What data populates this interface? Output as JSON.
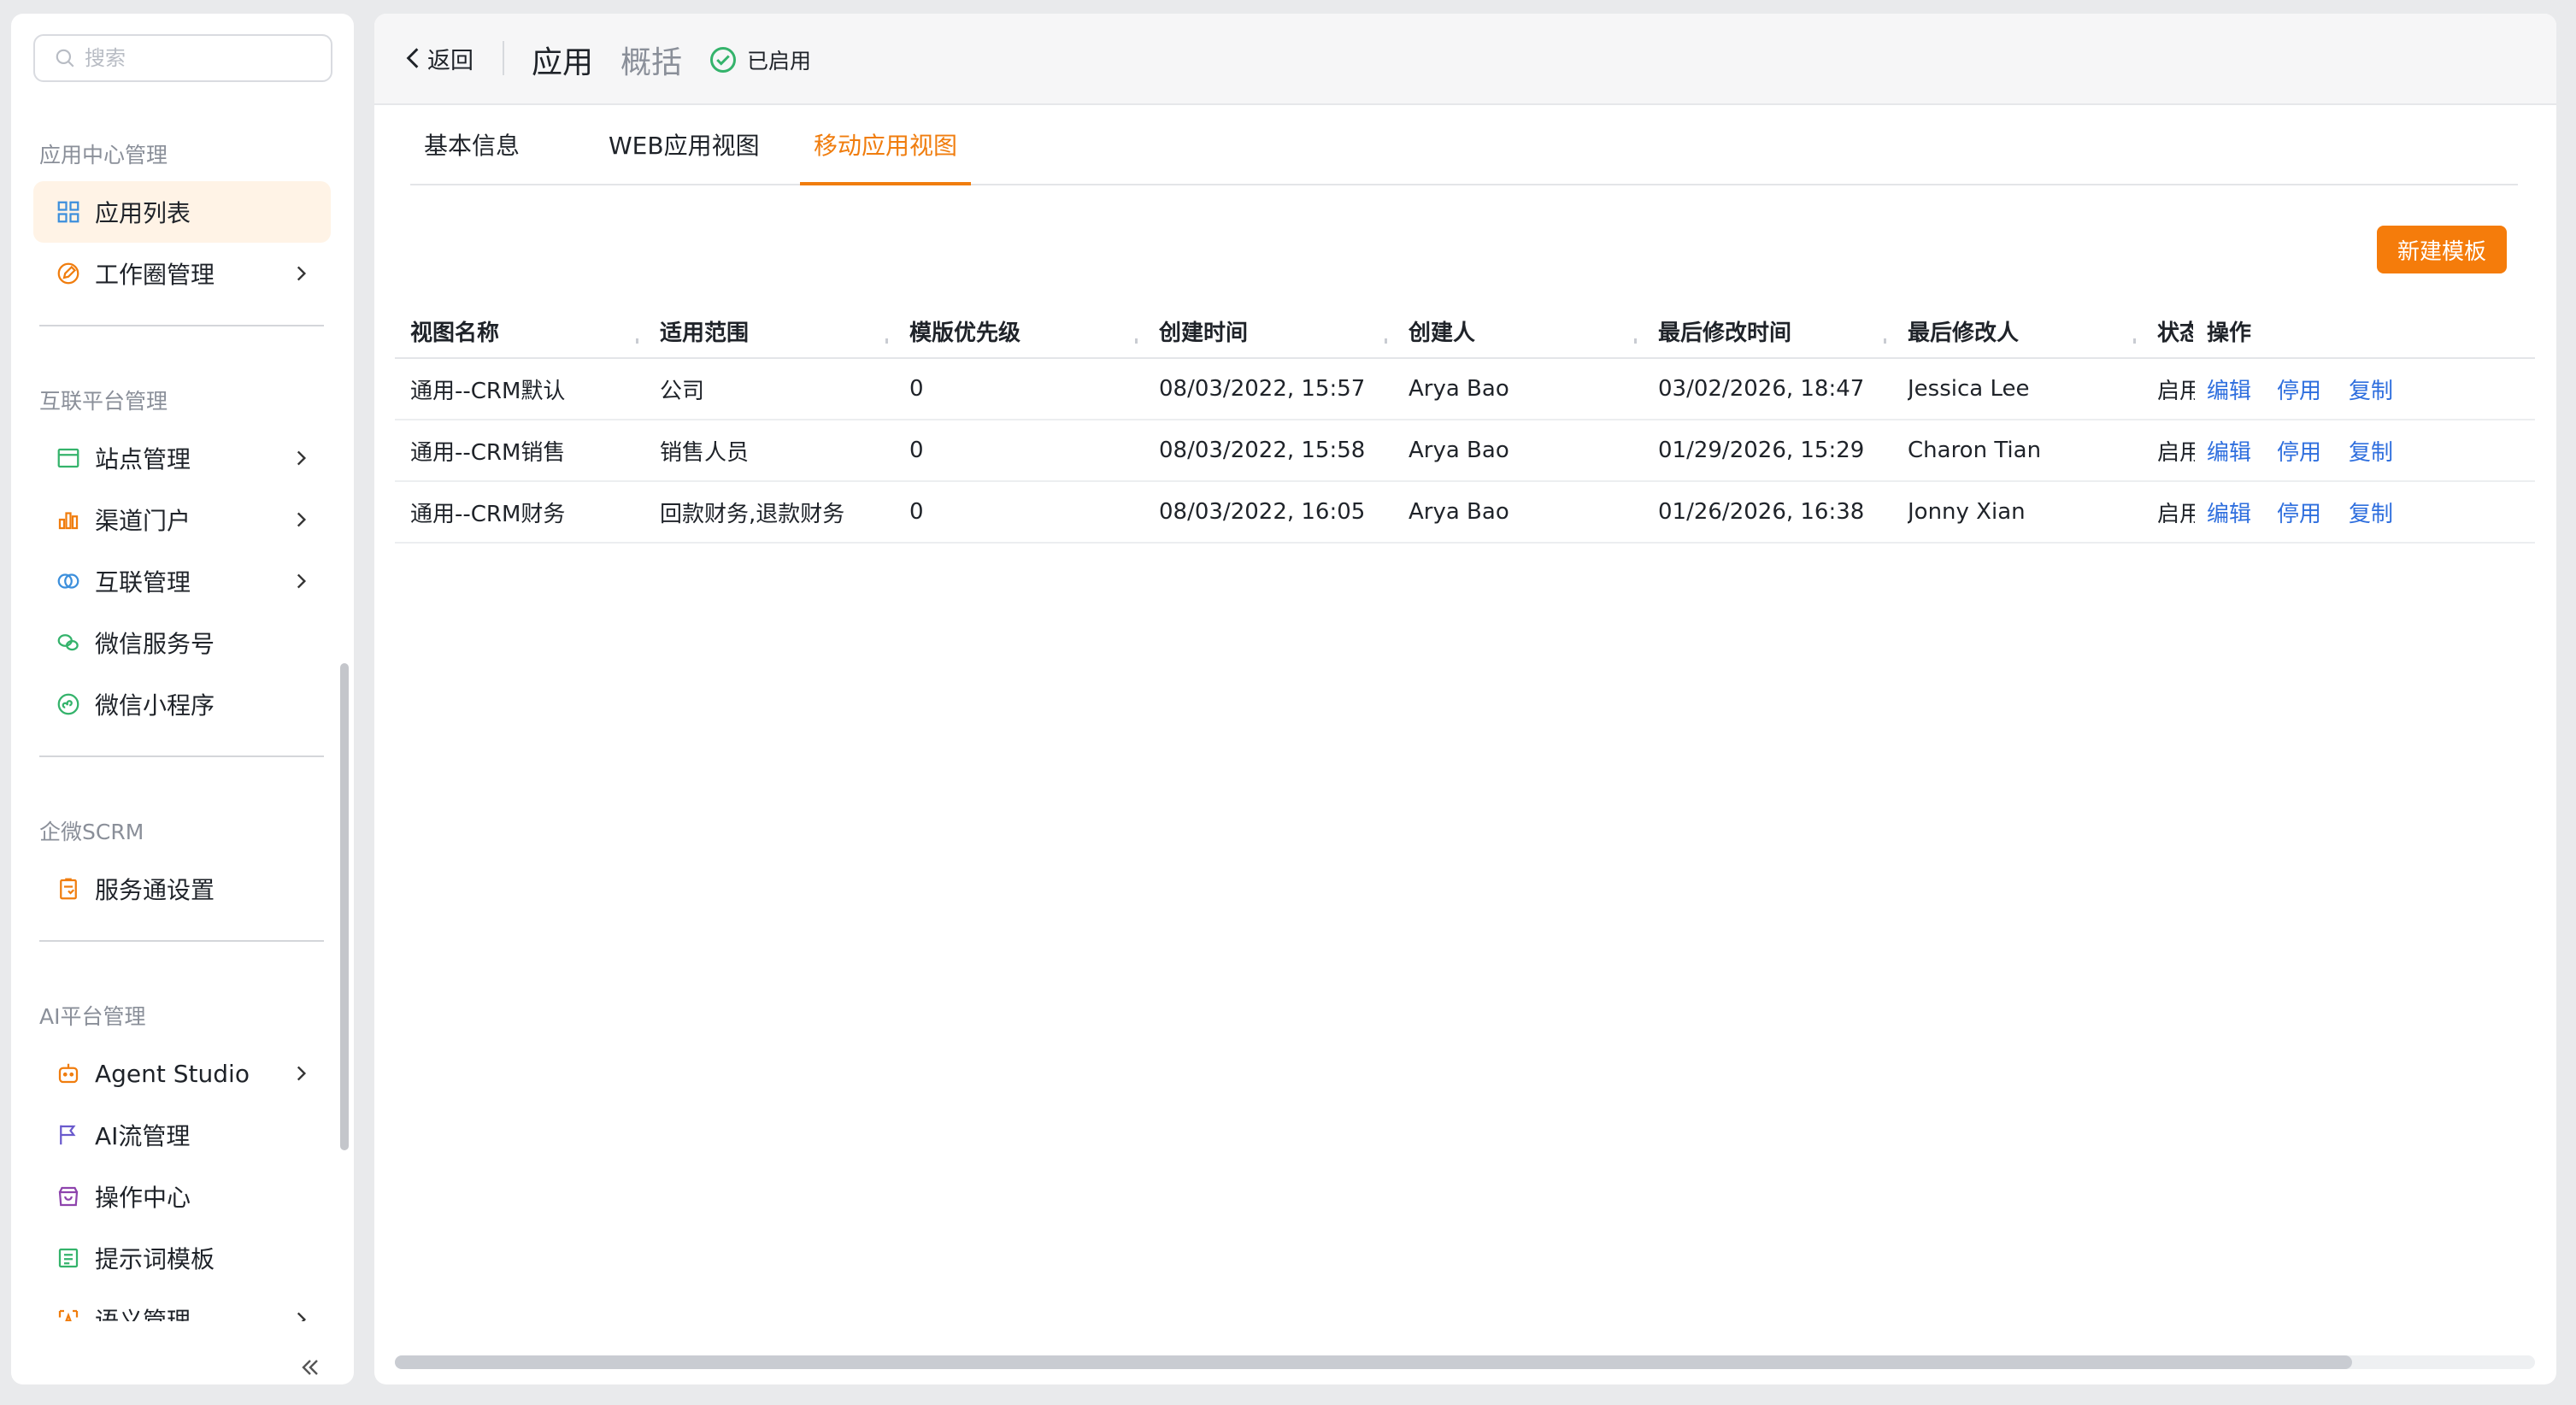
{
  "search": {
    "placeholder": "搜索"
  },
  "sidebar": {
    "sections": [
      {
        "title": "应用中心管理"
      },
      {
        "title": "互联平台管理"
      },
      {
        "title": "企微SCRM"
      },
      {
        "title": "AI平台管理"
      }
    ],
    "items": [
      {
        "label": "应用列表",
        "icon": "grid-icon",
        "active": true
      },
      {
        "label": "工作圈管理",
        "icon": "edit-circle-icon",
        "has_children": true
      },
      {
        "label": "站点管理",
        "icon": "site-icon",
        "has_children": true
      },
      {
        "label": "渠道门户",
        "icon": "bar-chart-icon",
        "has_children": true
      },
      {
        "label": "互联管理",
        "icon": "link-rings-icon",
        "has_children": true
      },
      {
        "label": "微信服务号",
        "icon": "wechat-icon"
      },
      {
        "label": "微信小程序",
        "icon": "mini-program-icon"
      },
      {
        "label": "服务通设置",
        "icon": "service-clipboard-icon"
      },
      {
        "label": "Agent Studio",
        "icon": "robot-icon",
        "has_children": true
      },
      {
        "label": "AI流管理",
        "icon": "flag-icon"
      },
      {
        "label": "操作中心",
        "icon": "store-icon"
      },
      {
        "label": "提示词模板",
        "icon": "list-doc-icon"
      },
      {
        "label": "语义管理",
        "icon": "semantic-icon",
        "has_children": true
      }
    ]
  },
  "header": {
    "back_label": "返回",
    "app_title": "应用",
    "overview_label": "概括",
    "status_label": "已启用"
  },
  "tabs": [
    {
      "label": "基本信息"
    },
    {
      "label": "WEB应用视图"
    },
    {
      "label": "移动应用视图",
      "active": true
    }
  ],
  "toolbar": {
    "new_template_label": "新建模板"
  },
  "table": {
    "columns": [
      "视图名称",
      "适用范围",
      "模版优先级",
      "创建时间",
      "创建人",
      "最后修改时间",
      "最后修改人",
      "状态",
      "操作"
    ],
    "rows": [
      {
        "name": "通用--CRM默认",
        "scope": "公司",
        "priority": "0",
        "created_at": "08/03/2022, 15:57",
        "creator": "Arya Bao",
        "modified_at": "03/02/2026, 18:47",
        "modifier": "Jessica Lee",
        "status": "启用"
      },
      {
        "name": "通用--CRM销售",
        "scope": "销售人员",
        "priority": "0",
        "created_at": "08/03/2022, 15:58",
        "creator": "Arya Bao",
        "modified_at": "01/29/2026, 15:29",
        "modifier": "Charon Tian",
        "status": "启用"
      },
      {
        "name": "通用--CRM财务",
        "scope": "回款财务,退款财务",
        "priority": "0",
        "created_at": "08/03/2022, 16:05",
        "creator": "Arya Bao",
        "modified_at": "01/26/2026, 16:38",
        "modifier": "Jonny Xian",
        "status": "启用"
      }
    ],
    "actions": {
      "edit": "编辑",
      "disable": "停用",
      "copy": "复制"
    }
  },
  "colors": {
    "accent": "#f57c0b",
    "link": "#2f6fde",
    "success": "#34b36b",
    "active_bg": "#fff3e6"
  }
}
